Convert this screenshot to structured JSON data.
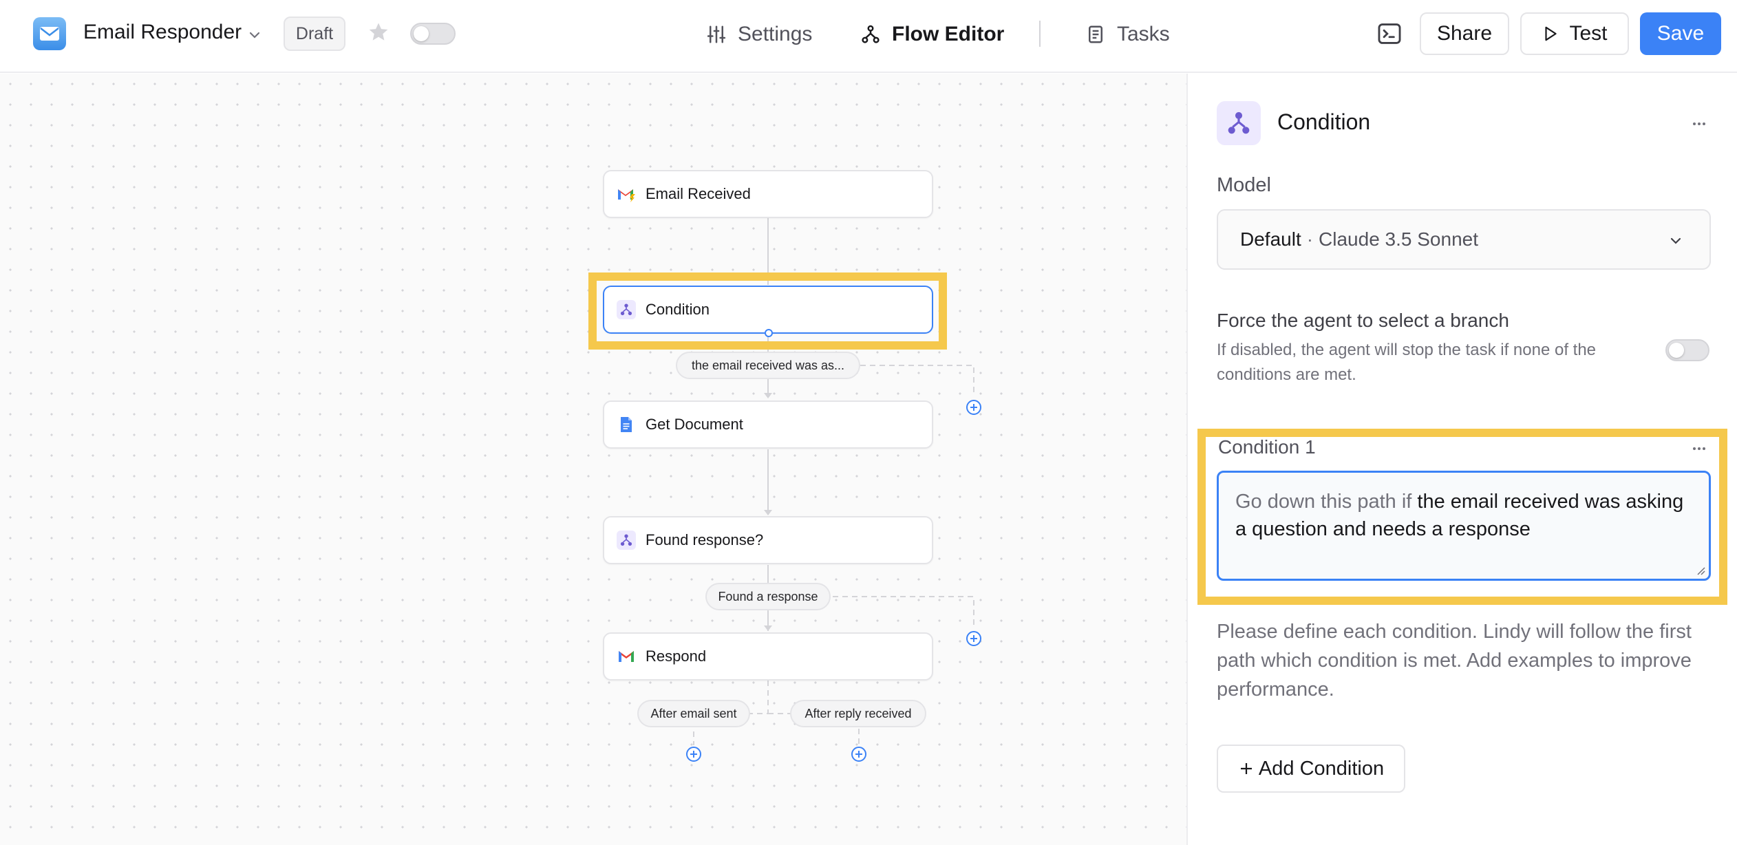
{
  "header": {
    "app_name": "Email Responder",
    "status_badge": "Draft",
    "nav": {
      "settings": "Settings",
      "flow_editor": "Flow Editor",
      "tasks": "Tasks"
    },
    "share_label": "Share",
    "test_label": "Test",
    "save_label": "Save",
    "accent_color": "#3b82f6"
  },
  "flow": {
    "nodes": [
      {
        "label": "Email Received",
        "icon": "gmail-trigger-icon"
      },
      {
        "label": "Condition",
        "icon": "branch-icon",
        "selected": true
      },
      {
        "label": "Get Document",
        "icon": "google-doc-icon"
      },
      {
        "label": "Found response?",
        "icon": "branch-icon"
      },
      {
        "label": "Respond",
        "icon": "gmail-icon"
      }
    ],
    "edge_labels": {
      "condition_branch": "the email received was as...",
      "found_branch": "Found a response",
      "after_sent": "After email sent",
      "after_reply": "After reply received"
    }
  },
  "panel": {
    "title": "Condition",
    "model_label": "Model",
    "model_default": "Default",
    "model_separator": "·",
    "model_name": "Claude 3.5 Sonnet",
    "force_title": "Force the agent to select a branch",
    "force_description": "If disabled, the agent will stop the task if none of the conditions are met.",
    "force_enabled": false,
    "condition_label": "Condition 1",
    "condition_prefix": "Go down this path if",
    "condition_text": "the email received was asking a question and needs a response",
    "help_text": "Please define each condition. Lindy will follow the first path which condition is met. Add examples to improve performance.",
    "add_condition_label": "Add Condition"
  }
}
